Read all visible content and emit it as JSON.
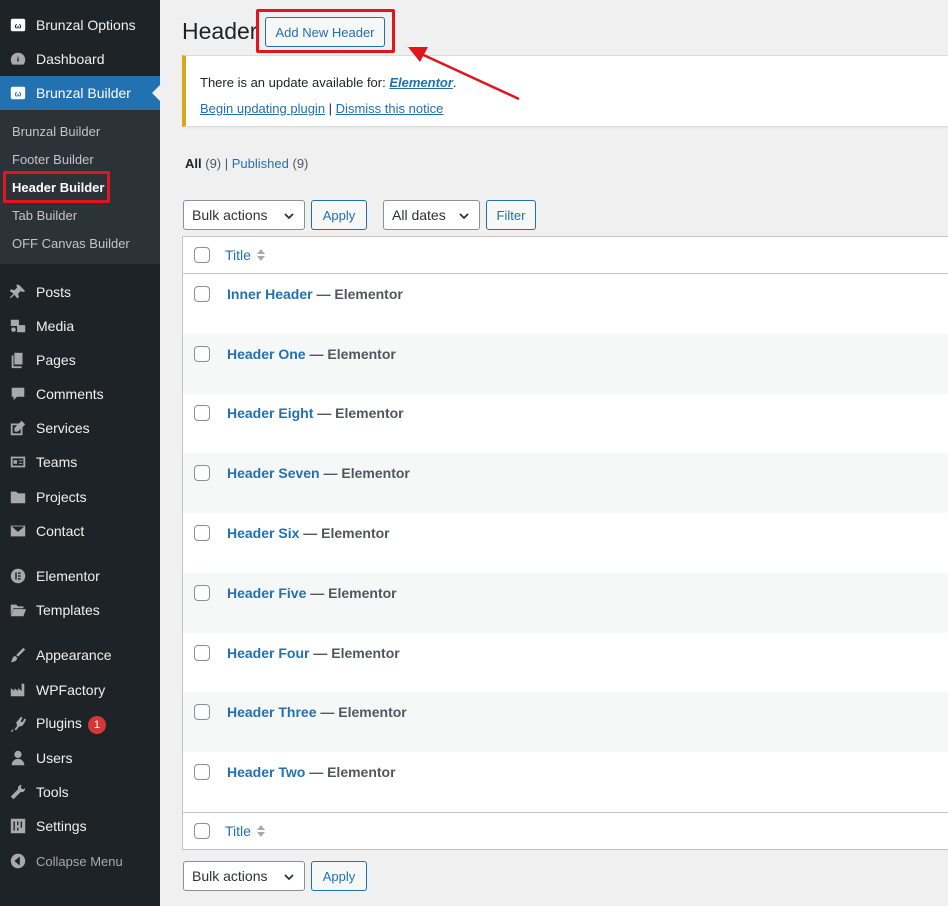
{
  "sidebar": {
    "top_items": [
      {
        "label": "Brunzal Options",
        "icon": "brunzal-logo-icon"
      },
      {
        "label": "Dashboard",
        "icon": "dashboard-gauge-icon"
      },
      {
        "label": "Brunzal Builder",
        "icon": "brunzal-logo-icon"
      }
    ],
    "submenu": [
      {
        "label": "Brunzal Builder"
      },
      {
        "label": "Footer Builder"
      },
      {
        "label": "Header Builder"
      },
      {
        "label": "Tab Builder"
      },
      {
        "label": "OFF Canvas Builder"
      }
    ],
    "items": [
      {
        "label": "Posts",
        "icon": "pushpin-icon"
      },
      {
        "label": "Media",
        "icon": "media-icon"
      },
      {
        "label": "Pages",
        "icon": "pages-icon"
      },
      {
        "label": "Comments",
        "icon": "comment-icon"
      },
      {
        "label": "Services",
        "icon": "edit-icon"
      },
      {
        "label": "Teams",
        "icon": "id-card-icon"
      },
      {
        "label": "Projects",
        "icon": "folder-icon"
      },
      {
        "label": "Contact",
        "icon": "envelope-icon"
      },
      {
        "label": "Elementor",
        "icon": "elementor-icon"
      },
      {
        "label": "Templates",
        "icon": "folder-open-icon"
      },
      {
        "label": "Appearance",
        "icon": "paintbrush-icon"
      },
      {
        "label": "WPFactory",
        "icon": "factory-icon"
      },
      {
        "label": "Plugins",
        "icon": "plugin-icon",
        "badge": "1"
      },
      {
        "label": "Users",
        "icon": "users-icon"
      },
      {
        "label": "Tools",
        "icon": "wrench-icon"
      },
      {
        "label": "Settings",
        "icon": "settings-sliders-icon"
      },
      {
        "label": "Collapse Menu",
        "icon": "collapse-icon"
      }
    ]
  },
  "header": {
    "title": "Header",
    "add_new_label": "Add New Header"
  },
  "notice": {
    "text": "There is an update available for: ",
    "plugin_link": "Elementor",
    "period": ".",
    "begin_link": "Begin updating plugin",
    "separator": " | ",
    "dismiss_link": "Dismiss this notice"
  },
  "views": {
    "all_label": "All",
    "all_count": "(9)",
    "sep": " | ",
    "published_label": "Published",
    "published_count": "(9)"
  },
  "tablenav": {
    "bulk_actions": "Bulk actions",
    "apply": "Apply",
    "dates": "All dates",
    "filter": "Filter"
  },
  "table": {
    "column_title": "Title",
    "state_separator": " — ",
    "rows": [
      {
        "title": "Inner Header",
        "state": "Elementor"
      },
      {
        "title": "Header One",
        "state": "Elementor"
      },
      {
        "title": "Header Eight",
        "state": "Elementor"
      },
      {
        "title": "Header Seven",
        "state": "Elementor"
      },
      {
        "title": "Header Six",
        "state": "Elementor"
      },
      {
        "title": "Header Five",
        "state": "Elementor"
      },
      {
        "title": "Header Four",
        "state": "Elementor"
      },
      {
        "title": "Header Three",
        "state": "Elementor"
      },
      {
        "title": "Header Two",
        "state": "Elementor"
      }
    ]
  },
  "colors": {
    "sidebar_bg": "#1d2327",
    "accent": "#2271b1",
    "highlight": "#e0151d",
    "notice_border": "#dba617"
  }
}
